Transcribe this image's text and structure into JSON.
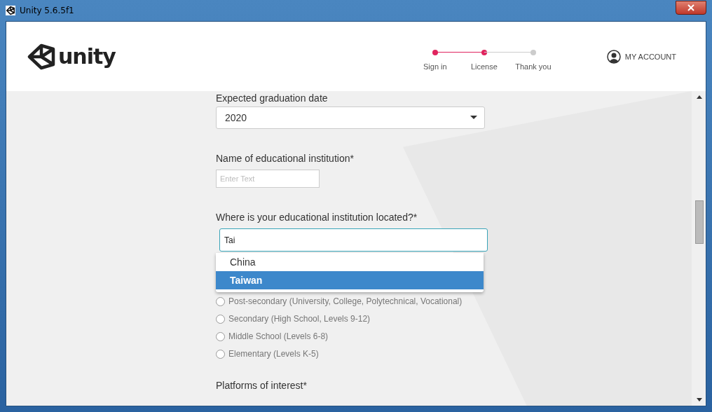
{
  "window": {
    "title": "Unity 5.6.5f1"
  },
  "header": {
    "logo_text": "unity",
    "steps": [
      {
        "label": "Sign in",
        "completed": true
      },
      {
        "label": "License",
        "completed": true
      },
      {
        "label": "Thank you",
        "completed": false
      }
    ],
    "account": "MY ACCOUNT"
  },
  "form": {
    "graduation": {
      "label": "Expected graduation date",
      "value": "2020"
    },
    "institution": {
      "label": "Name of educational institution*",
      "placeholder": "Enter Text"
    },
    "location": {
      "label": "Where is your educational institution located?*",
      "value": "Tai",
      "options": [
        {
          "label": "China",
          "selected": false
        },
        {
          "label": "Taiwan",
          "selected": true
        }
      ]
    },
    "levels": [
      {
        "label": "Post-secondary (University, College, Polytechnical, Vocational)",
        "selected": false
      },
      {
        "label": "Secondary (High School, Levels 9-12)",
        "selected": false
      },
      {
        "label": "Middle School (Levels 6-8)",
        "selected": false
      },
      {
        "label": "Elementary (Levels K-5)",
        "selected": false
      }
    ],
    "platforms_label": "Platforms of interest*"
  }
}
